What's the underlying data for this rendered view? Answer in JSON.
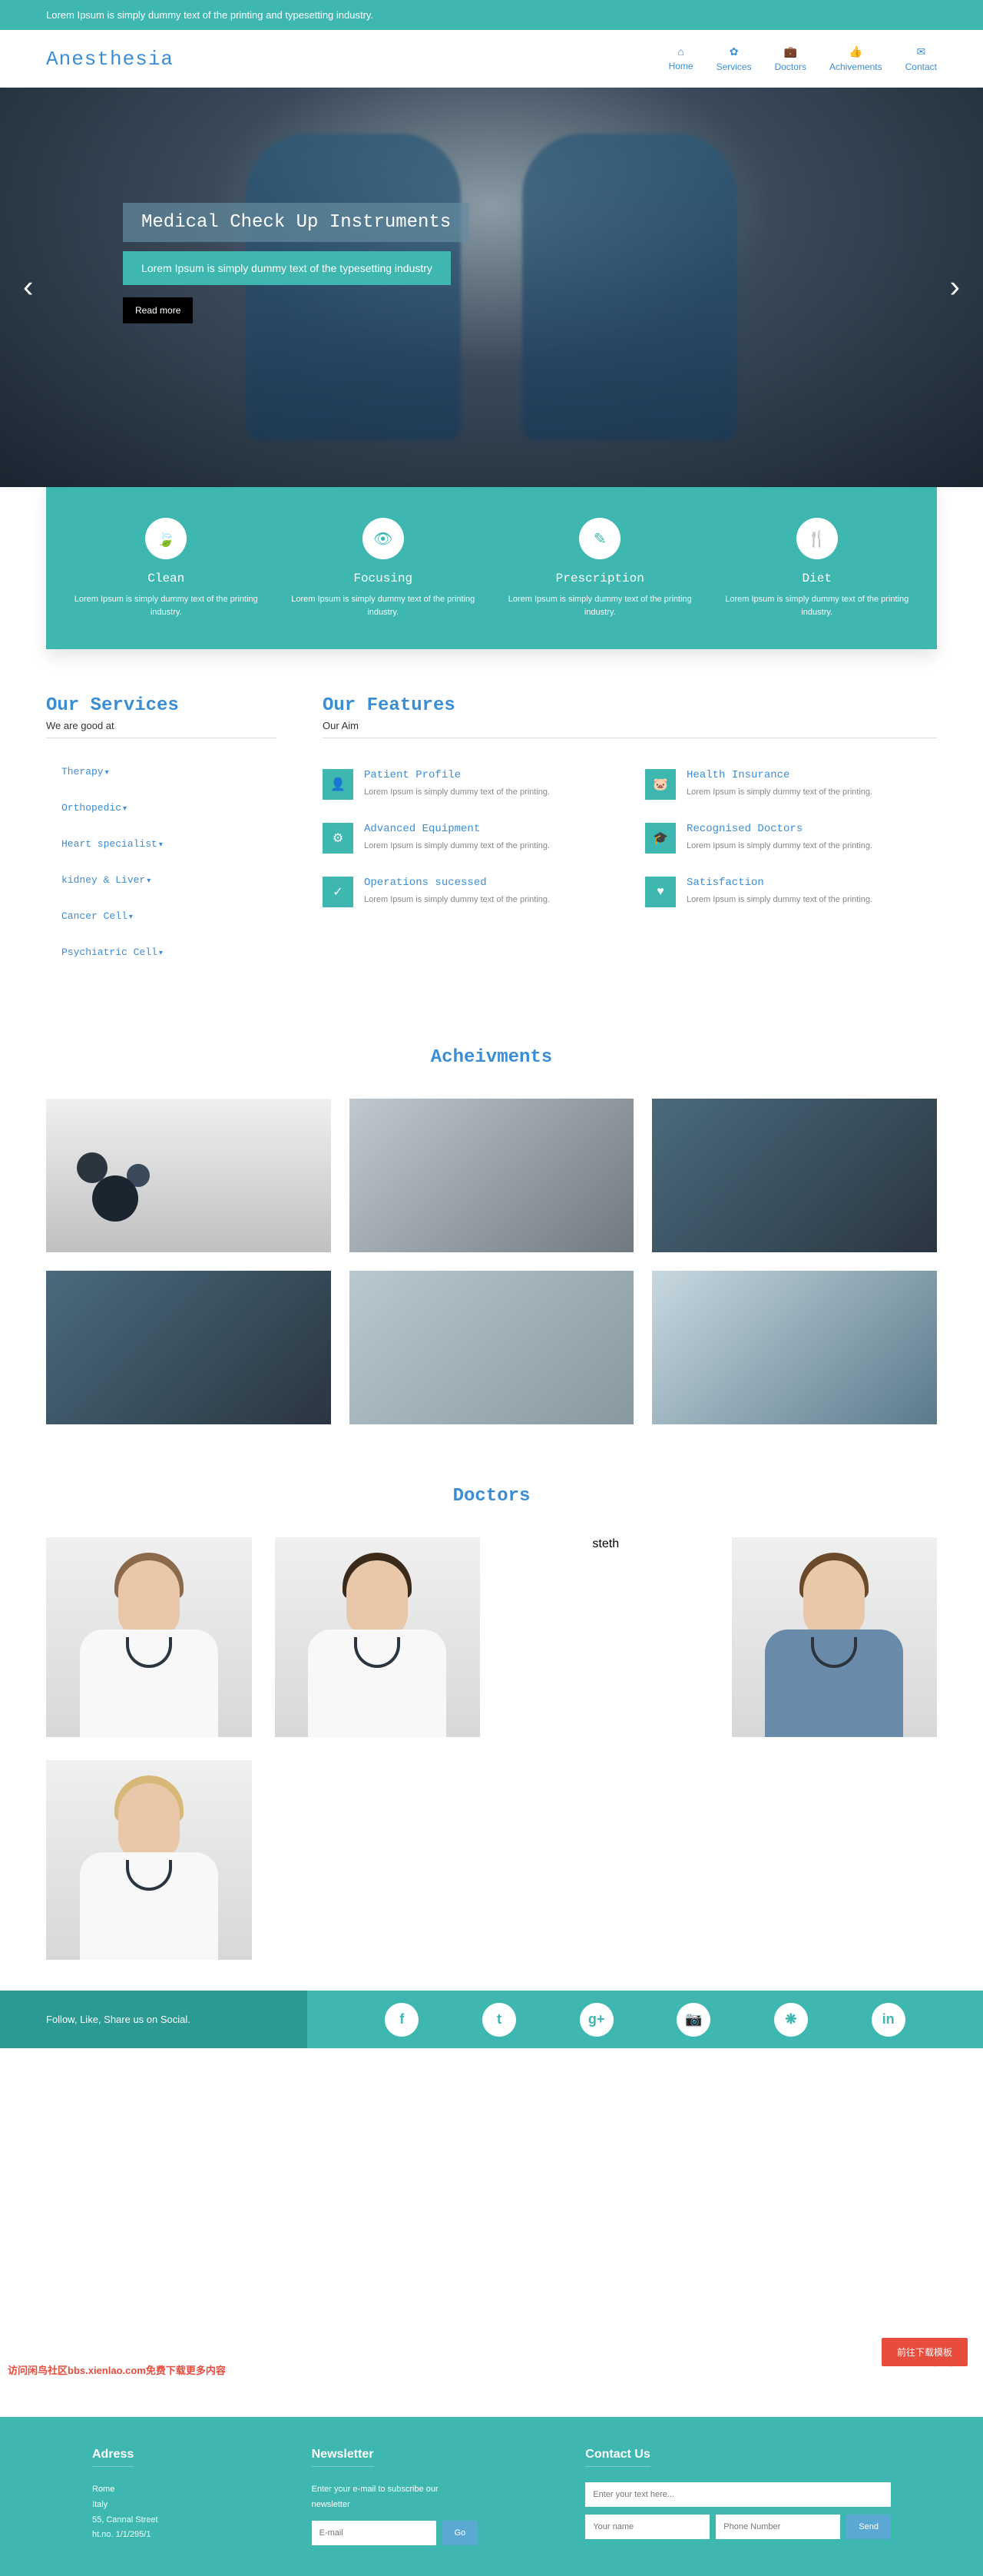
{
  "topbar": {
    "text": "Lorem Ipsum is simply dummy text of the printing and typesetting industry."
  },
  "header": {
    "logo": "Anesthesia",
    "nav": [
      {
        "label": "Home",
        "icon": "⌂"
      },
      {
        "label": "Services",
        "icon": "✿"
      },
      {
        "label": "Doctors",
        "icon": "💼"
      },
      {
        "label": "Achivements",
        "icon": "👍"
      },
      {
        "label": "Contact",
        "icon": "✉"
      }
    ]
  },
  "hero": {
    "title": "Medical Check Up Instruments",
    "subtitle": "Lorem Ipsum is simply dummy text of the typesetting industry",
    "button": "Read more"
  },
  "iconcards": [
    {
      "title": "Clean",
      "icon": "🍃",
      "text": "Lorem Ipsum is simply dummy text of the printing industry."
    },
    {
      "title": "Focusing",
      "icon": "👁",
      "text": "Lorem Ipsum is simply dummy text of the printing industry."
    },
    {
      "title": "Prescription",
      "icon": "✎",
      "text": "Lorem Ipsum is simply dummy text of the printing industry."
    },
    {
      "title": "Diet",
      "icon": "🍴",
      "text": "Lorem Ipsum is simply dummy text of the printing industry."
    }
  ],
  "services": {
    "title": "Our Services",
    "sub": "We are good at",
    "items": [
      "Therapy",
      "Orthopedic",
      "Heart specialist",
      "kidney & Liver",
      "Cancer Cell",
      "Psychiatric Cell"
    ]
  },
  "features": {
    "title": "Our Features",
    "sub": "Our Aim",
    "items": [
      {
        "title": "Patient Profile",
        "icon": "👤",
        "text": "Lorem Ipsum is simply dummy text of the printing."
      },
      {
        "title": "Health Insurance",
        "icon": "🐷",
        "text": "Lorem Ipsum is simply dummy text of the printing."
      },
      {
        "title": "Advanced Equipment",
        "icon": "⚙",
        "text": "Lorem Ipsum is simply dummy text of the printing."
      },
      {
        "title": "Recognised Doctors",
        "icon": "🎓",
        "text": "Lorem Ipsum is simply dummy text of the printing."
      },
      {
        "title": "Operations sucessed",
        "icon": "✓",
        "text": "Lorem Ipsum is simply dummy text of the printing."
      },
      {
        "title": "Satisfaction",
        "icon": "♥",
        "text": "Lorem Ipsum is simply dummy text of the printing."
      }
    ]
  },
  "achievements": {
    "title": "Acheivments"
  },
  "doctors": {
    "title": "Doctors"
  },
  "social": {
    "text": "Follow, Like, Share us on Social.",
    "icons": [
      "f",
      "t",
      "g+",
      "📷",
      "❋",
      "in"
    ]
  },
  "footer": {
    "address": {
      "title": "Adress",
      "lines": "Rome\nItaly\n55, Cannal Street\nht.no. 1/1/295/1"
    },
    "newsletter": {
      "title": "Newsletter",
      "text": "Enter your e-mail to subscribe our newsletter",
      "placeholder": "E-mail",
      "button": "Go"
    },
    "contact": {
      "title": "Contact Us",
      "text_ph": "Enter your text here...",
      "name_ph": "Your name",
      "phone_ph": "Phone Number",
      "button": "Send"
    }
  },
  "download_btn": "前往下载模板",
  "watermark": "访问闲鸟社区bbs.xienlao.com免费下载更多内容"
}
